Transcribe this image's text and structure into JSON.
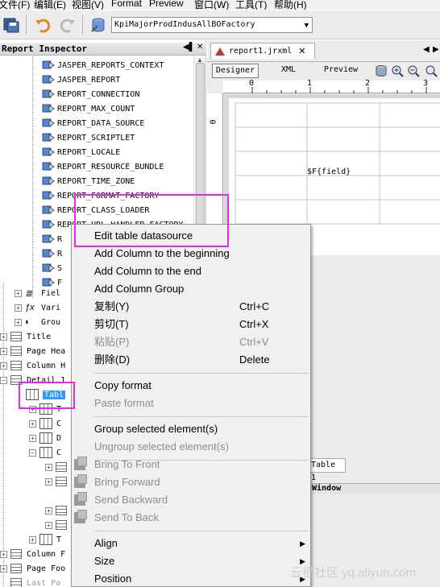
{
  "menubar": {
    "items": [
      "文件(F)",
      "编辑(E)",
      "视图(V)",
      "Format",
      "Preview",
      "窗口(W)",
      "工具(T)",
      "帮助(H)"
    ]
  },
  "toolbar": {
    "datasource_combo": "KpiMajorProdIndusAllBOFactory"
  },
  "left_panel": {
    "title": "Report Inspector",
    "parameters": [
      "JASPER_REPORTS_CONTEXT",
      "JASPER_REPORT",
      "REPORT_CONNECTION",
      "REPORT_MAX_COUNT",
      "REPORT_DATA_SOURCE",
      "REPORT_SCRIPTLET",
      "REPORT_LOCALE",
      "REPORT_RESOURCE_BUNDLE",
      "REPORT_TIME_ZONE",
      "REPORT_FORMAT_FACTORY",
      "REPORT_CLASS_LOADER",
      "REPORT_URL_HANDLER_FACTORY",
      "R",
      "R",
      "S",
      "F"
    ],
    "groups": [
      "Fiel",
      "Vari",
      "Grou"
    ],
    "bands": [
      "Title",
      "Page Hea",
      "Column H",
      "Detail 1"
    ],
    "table_node": "Tabl",
    "table_children": [
      "T",
      "C",
      "D",
      "C"
    ],
    "table_last_child": "T",
    "bottom_bands": [
      "Column F",
      "Page Foo",
      "Last Pa"
    ]
  },
  "editor": {
    "tab_label": "report1.jrxml",
    "views": [
      "Designer",
      "XML",
      "Preview"
    ],
    "ruler_marks": [
      "0",
      "1",
      "2",
      "3"
    ],
    "field_placeholder": "$F{field}",
    "table_tab": "Table 1",
    "window_title": "Window"
  },
  "context_menu": {
    "edit_table_datasource": "Edit table datasource",
    "add_column_beginning": "Add Column to the beginning",
    "add_column_end": "Add Column to the end",
    "add_column_group": "Add Column Group",
    "copy": {
      "label": "复制(Y)",
      "shortcut": "Ctrl+C"
    },
    "cut": {
      "label": "剪切(T)",
      "shortcut": "Ctrl+X"
    },
    "paste": {
      "label": "粘贴(P)",
      "shortcut": "Ctrl+V"
    },
    "delete": {
      "label": "删除(D)",
      "shortcut": "Delete"
    },
    "copy_format": "Copy format",
    "paste_format": "Paste format",
    "group_selected": "Group selected element(s)",
    "ungroup_selected": "Ungroup selected element(s)",
    "bring_to_front": "Bring To Front",
    "bring_forward": "Bring Forward",
    "send_backward": "Send Backward",
    "send_to_back": "Send To Back",
    "align": "Align",
    "size": "Size",
    "position": "Position"
  },
  "watermark": "云栖社区 yq.aliyun.com",
  "colors": {
    "highlight": "#e52ae5",
    "selection": "#3399ff",
    "menu_bg": "#f0f0f0",
    "disabled_text": "#8d8d8d"
  }
}
